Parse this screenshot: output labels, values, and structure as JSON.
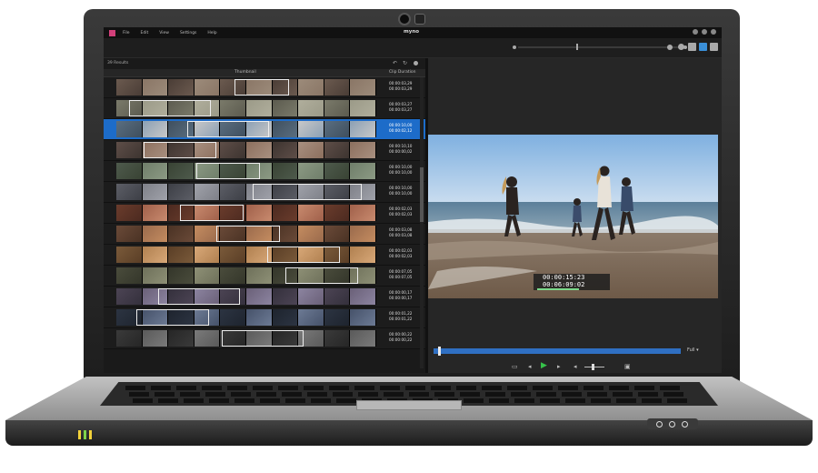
{
  "app": {
    "title": "myno",
    "menu": [
      "File",
      "Edit",
      "View",
      "Settings",
      "Help"
    ]
  },
  "results": {
    "label": "39  Results"
  },
  "columns": {
    "thumbnail": "Thumbnail",
    "clip_duration": "Clip Duration"
  },
  "rows": [
    {
      "d1": "00:00:03,29",
      "d2": "00:00:03,29",
      "selected": false
    },
    {
      "d1": "00:00:03,27",
      "d2": "00:00:03,27",
      "selected": false
    },
    {
      "d1": "00:00:10,00",
      "d2": "00:00:02,12",
      "selected": true
    },
    {
      "d1": "00:00:10,10",
      "d2": "00:00:00,02",
      "selected": false
    },
    {
      "d1": "00:00:10,00",
      "d2": "00:00:10,00",
      "selected": false
    },
    {
      "d1": "00:00:10,00",
      "d2": "00:00:10,00",
      "selected": false
    },
    {
      "d1": "00:00:02,03",
      "d2": "00:00:02,03",
      "selected": false
    },
    {
      "d1": "00:00:03,08",
      "d2": "00:00:03,08",
      "selected": false
    },
    {
      "d1": "00:00:02,03",
      "d2": "00:00:02,03",
      "selected": false
    },
    {
      "d1": "00:00:07,05",
      "d2": "00:00:07,05",
      "selected": false
    },
    {
      "d1": "00:00:00,17",
      "d2": "00:00:00,17",
      "selected": false
    },
    {
      "d1": "00:00:01,22",
      "d2": "00:00:01,22",
      "selected": false
    },
    {
      "d1": "00:00:00,22",
      "d2": "00:00:00,22",
      "selected": false
    }
  ],
  "player": {
    "timecode_current": "00:00:15:23",
    "timecode_total": "00:06:09:02",
    "view_mode": "Full",
    "playback_progress": 0.02
  },
  "colors": {
    "accent": "#1d6cc9",
    "play": "#36c24a",
    "brand": "#d2407a"
  }
}
